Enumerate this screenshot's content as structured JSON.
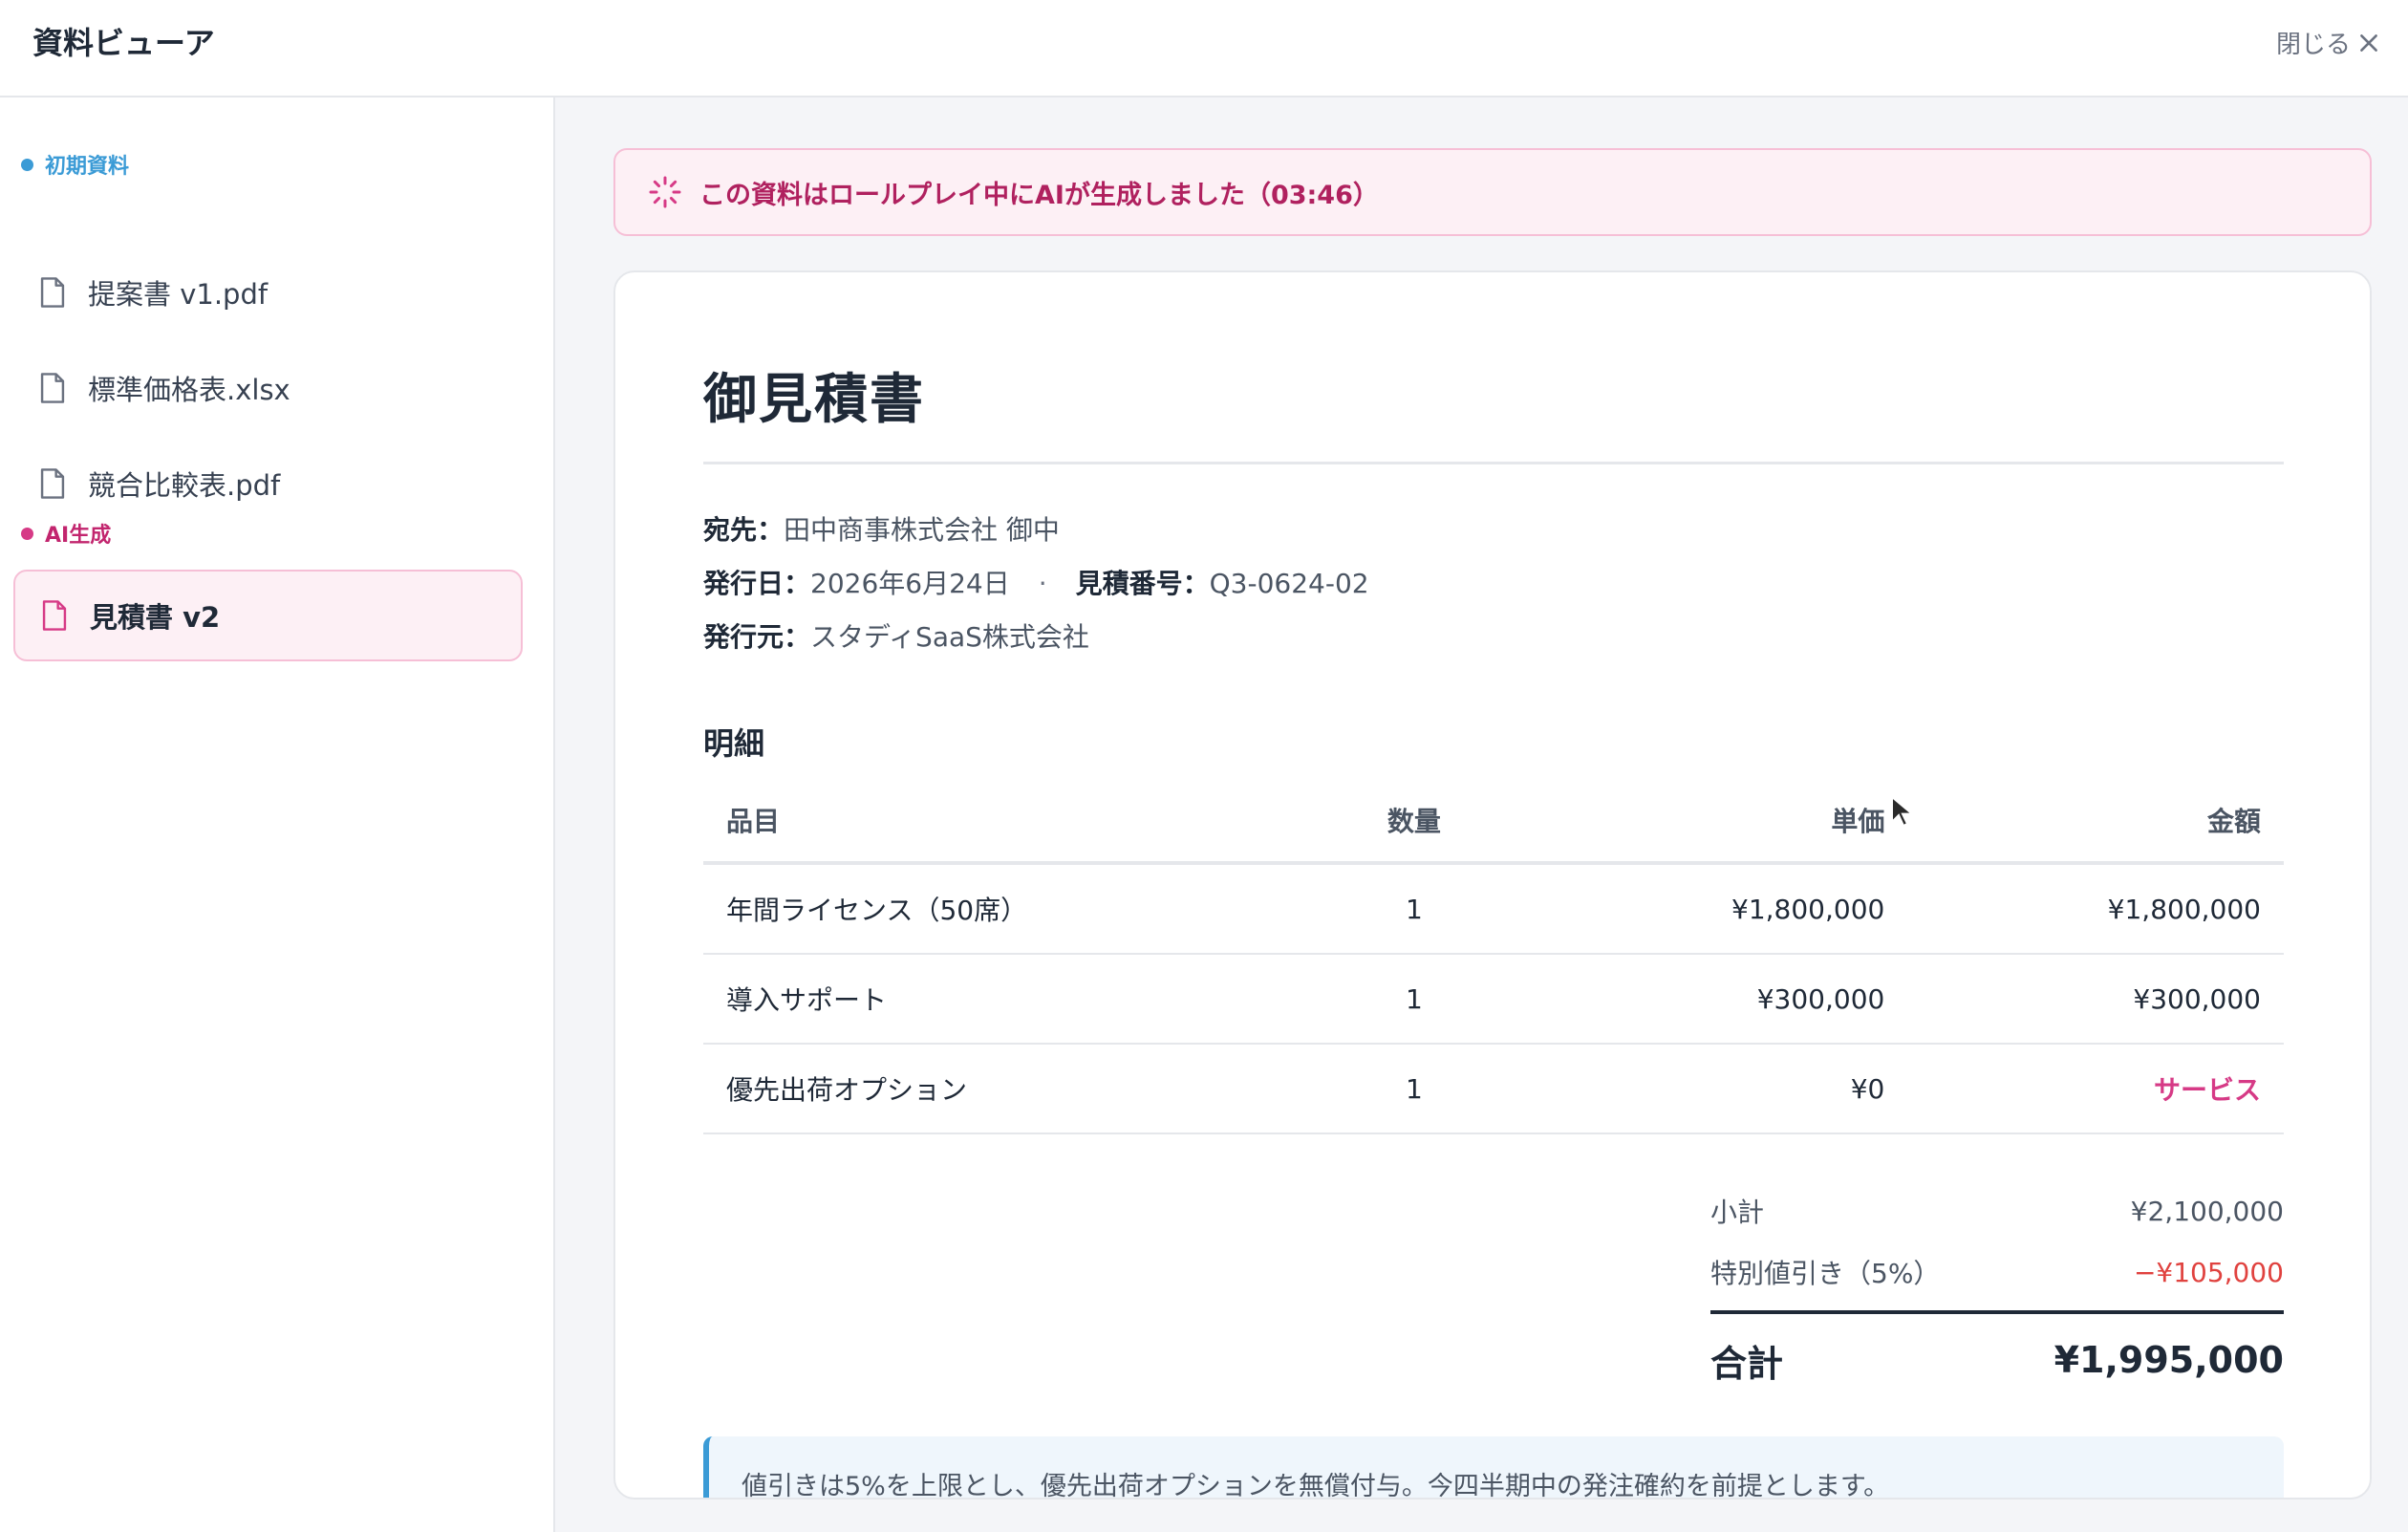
{
  "header": {
    "title": "資料ビューア",
    "close_label": "閉じる"
  },
  "sidebar": {
    "sections": [
      {
        "label": "初期資料",
        "color": "#3b9bd6",
        "files": [
          {
            "label": "提案書 v1.pdf",
            "icon": "file-icon"
          },
          {
            "label": "標準価格表.xlsx",
            "icon": "file-icon"
          },
          {
            "label": "競合比較表.pdf",
            "icon": "file-icon"
          }
        ]
      },
      {
        "label": "AI生成",
        "color": "#d63a86",
        "files": [
          {
            "label": "見積書 v2",
            "icon": "file-icon",
            "selected": true
          }
        ]
      }
    ]
  },
  "banner": {
    "text": "この資料はロールプレイ中にAIが生成しました（03:46）",
    "icon": "spinner-icon"
  },
  "document": {
    "title": "御見積書",
    "recipient_label": "宛先：",
    "recipient_value": "田中商事株式会社 御中",
    "date_label": "発行日：",
    "date_value": "2026年6月24日",
    "separator": "·",
    "quote_no_label": "見積番号：",
    "quote_no_value": "Q3-0624-02",
    "issuer_label": "発行元：",
    "issuer_value": "スタディSaaS株式会社",
    "details_title": "明細",
    "table": {
      "headers": [
        "品目",
        "数量",
        "単価",
        "金額"
      ],
      "rows": [
        [
          "年間ライセンス（50席）",
          "1",
          "¥1,800,000",
          "¥1,800,000"
        ],
        [
          "導入サポート",
          "1",
          "¥300,000",
          "¥300,000"
        ],
        [
          "優先出荷オプション",
          "1",
          "¥0",
          "サービス"
        ]
      ]
    },
    "totals": {
      "subtotal_label": "小計",
      "subtotal_value": "¥2,100,000",
      "discount_label": "特別値引き（5%）",
      "discount_value": "−¥105,000",
      "total_label": "合計",
      "total_value": "¥1,995,000"
    },
    "note": "値引きは5%を上限とし、優先出荷オプションを無償付与。今四半期中の発注確約を前提とします。"
  },
  "colors": {
    "accent_blue": "#3b9bd6",
    "accent_pink": "#d63a86",
    "discount_red": "#e0423f"
  }
}
